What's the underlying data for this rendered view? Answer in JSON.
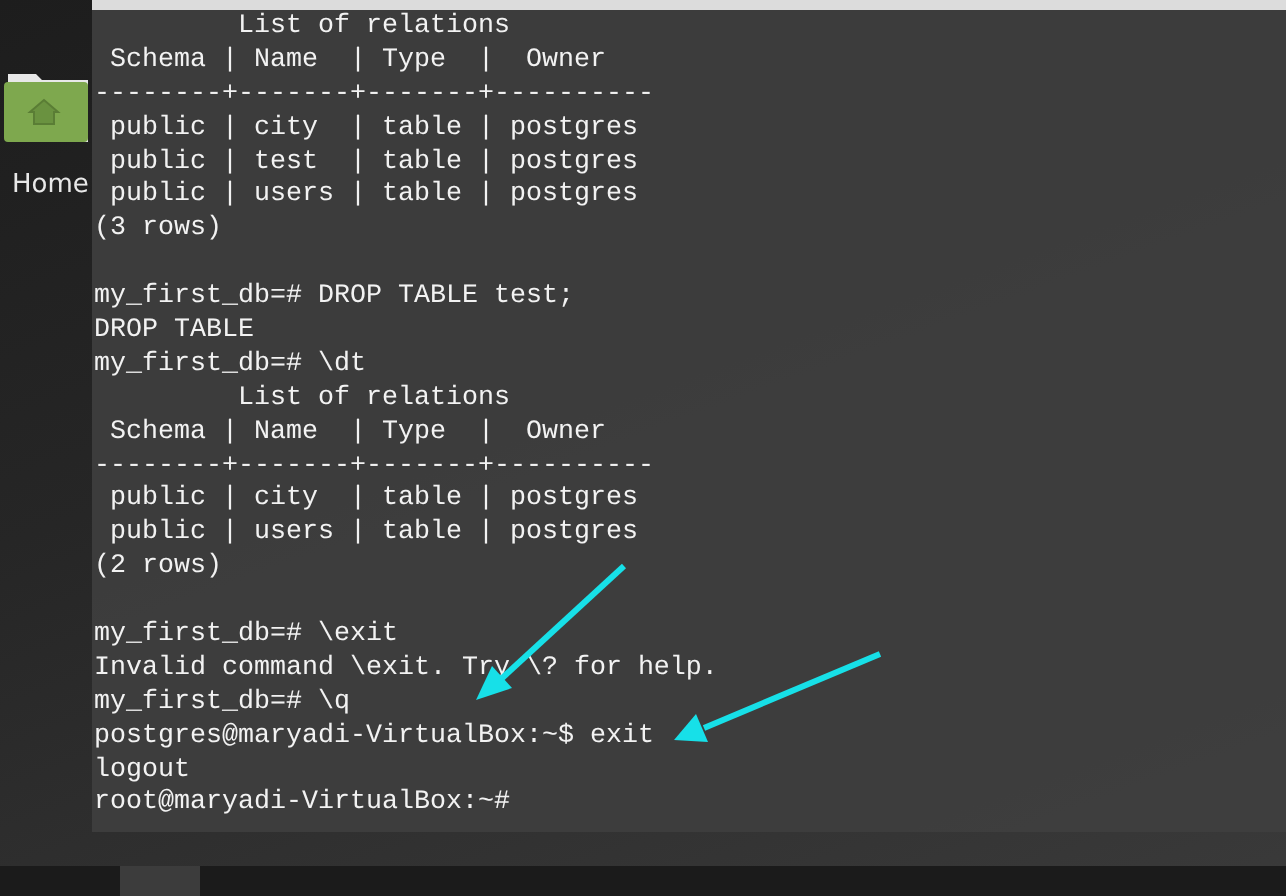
{
  "desktop": {
    "icons": [
      {
        "label": "Home"
      }
    ]
  },
  "terminal": {
    "lines": [
      {
        "kind": "output",
        "text": "         List of relations"
      },
      {
        "kind": "output",
        "text": " Schema | Name  | Type  |  Owner   "
      },
      {
        "kind": "output",
        "text": "--------+-------+-------+----------"
      },
      {
        "kind": "output",
        "text": " public | city  | table | postgres"
      },
      {
        "kind": "output",
        "text": " public | test  | table | postgres"
      },
      {
        "kind": "output",
        "text": " public | users | table | postgres"
      },
      {
        "kind": "output",
        "text": "(3 rows)"
      },
      {
        "kind": "blank"
      },
      {
        "kind": "command",
        "text": "my_first_db=# DROP TABLE test;"
      },
      {
        "kind": "output",
        "text": "DROP TABLE"
      },
      {
        "kind": "command",
        "text": "my_first_db=# \\dt"
      },
      {
        "kind": "output",
        "text": "         List of relations"
      },
      {
        "kind": "output",
        "text": " Schema | Name  | Type  |  Owner   "
      },
      {
        "kind": "output",
        "text": "--------+-------+-------+----------"
      },
      {
        "kind": "output",
        "text": " public | city  | table | postgres"
      },
      {
        "kind": "output",
        "text": " public | users | table | postgres"
      },
      {
        "kind": "output",
        "text": "(2 rows)"
      },
      {
        "kind": "blank"
      },
      {
        "kind": "command",
        "text": "my_first_db=# \\exit"
      },
      {
        "kind": "output",
        "text": "Invalid command \\exit. Try \\? for help."
      },
      {
        "kind": "command",
        "text": "my_first_db=# \\q"
      },
      {
        "kind": "command",
        "text": "postgres@maryadi-VirtualBox:~$ exit"
      },
      {
        "kind": "output",
        "text": "logout"
      },
      {
        "kind": "command",
        "text": "root@maryadi-VirtualBox:~#"
      }
    ]
  }
}
